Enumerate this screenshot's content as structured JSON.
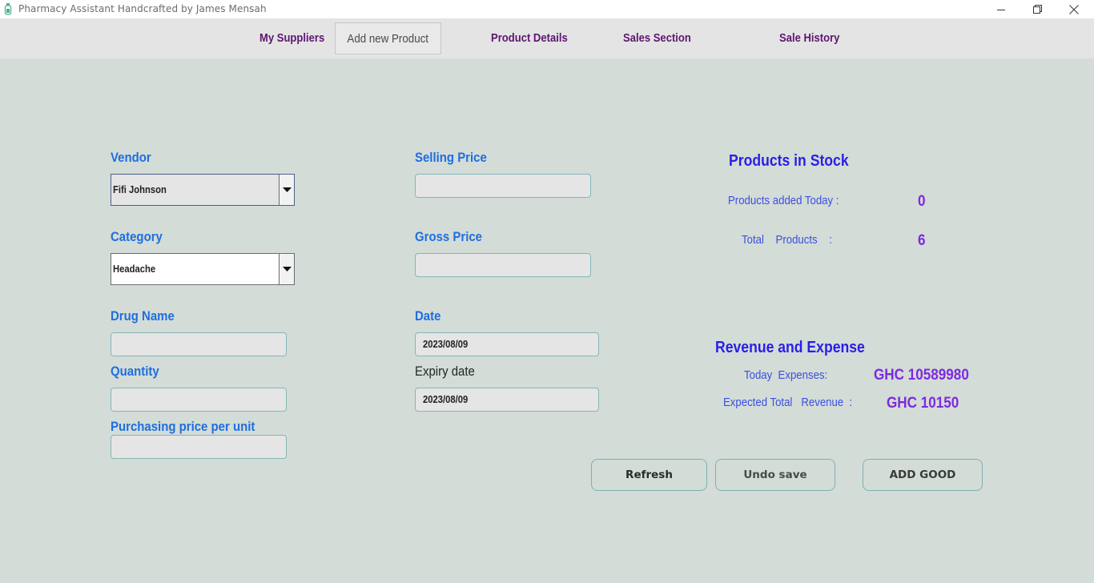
{
  "window": {
    "title": "Pharmacy Assistant Handcrafted by James Mensah",
    "controls": [
      "minimize-icon",
      "restore-icon",
      "close-icon"
    ]
  },
  "nav": {
    "tabs": [
      {
        "label": "My Suppliers",
        "active": false
      },
      {
        "label": "Add new Product",
        "active": true
      },
      {
        "label": "Product Details",
        "active": false
      },
      {
        "label": "Sales Section",
        "active": false
      },
      {
        "label": "Sale History",
        "active": false
      }
    ]
  },
  "form": {
    "vendor": {
      "label": "Vendor",
      "value": "Fifi Johnson"
    },
    "category": {
      "label": "Category",
      "value": "Headache"
    },
    "drug_name": {
      "label": "Drug Name",
      "value": ""
    },
    "quantity": {
      "label": "Quantity",
      "value": ""
    },
    "purchasing_price": {
      "label": "Purchasing price per unit",
      "value": ""
    },
    "selling_price": {
      "label": "Selling Price",
      "value": ""
    },
    "gross_price": {
      "label": "Gross Price",
      "value": ""
    },
    "date": {
      "label": "Date",
      "value": "2023/08/09"
    },
    "expiry_date": {
      "label": "Expiry date",
      "value": "2023/08/09"
    }
  },
  "stock": {
    "heading": "Products in Stock",
    "added_today_label": "Products added Today  :",
    "added_today_value": "0",
    "total_label": "Total    Products    :",
    "total_value": "6"
  },
  "revenue": {
    "heading": "Revenue and Expense",
    "expenses_label": "Today  Expenses:",
    "expenses_value": "GHC 10589980",
    "expected_label": "Expected Total   Revenue  :",
    "expected_value": "GHC 10150"
  },
  "buttons": {
    "refresh": "Refresh",
    "undo": "Undo save",
    "add": "ADD GOOD"
  },
  "colors": {
    "background": "#d3dcd7",
    "nav_bar": "#e4e4e4",
    "nav_text": "#5e1670",
    "label_blue": "#1f6ee0",
    "heading_blue": "#2a1ee8",
    "value_purple": "#7e2ae0"
  }
}
